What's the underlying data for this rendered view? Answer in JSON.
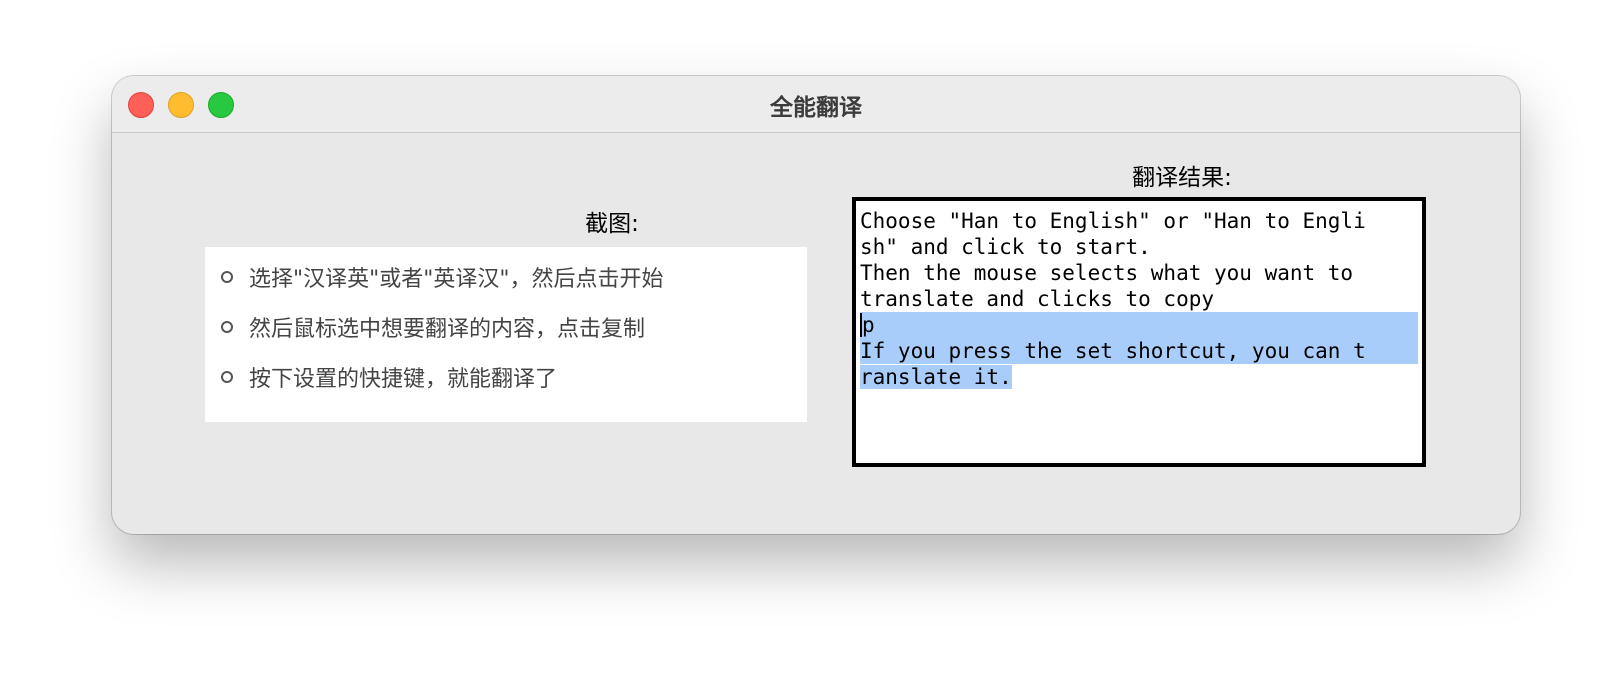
{
  "window": {
    "title": "全能翻译"
  },
  "screenshot_panel": {
    "label": "截图:",
    "items": [
      "选择\"汉译英\"或者\"英译汉\"，然后点击开始",
      "然后鼠标选中想要翻译的内容，点击复制",
      "按下设置的快捷键，就能翻译了"
    ]
  },
  "result_panel": {
    "label": "翻译结果:",
    "lines": [
      "Choose \"Han to English\" or \"Han to Engli",
      "sh\" and click to start.",
      "Then the mouse selects what you want to",
      "translate and clicks to copy",
      "p",
      "If you press the set shortcut, you can t",
      "ranslate it."
    ],
    "selection_highlight": "#a9cdfb"
  },
  "colors": {
    "close": "#fe5f57",
    "minimize": "#febc2e",
    "maximize": "#28c840",
    "window_bg": "#e8e8e8"
  }
}
